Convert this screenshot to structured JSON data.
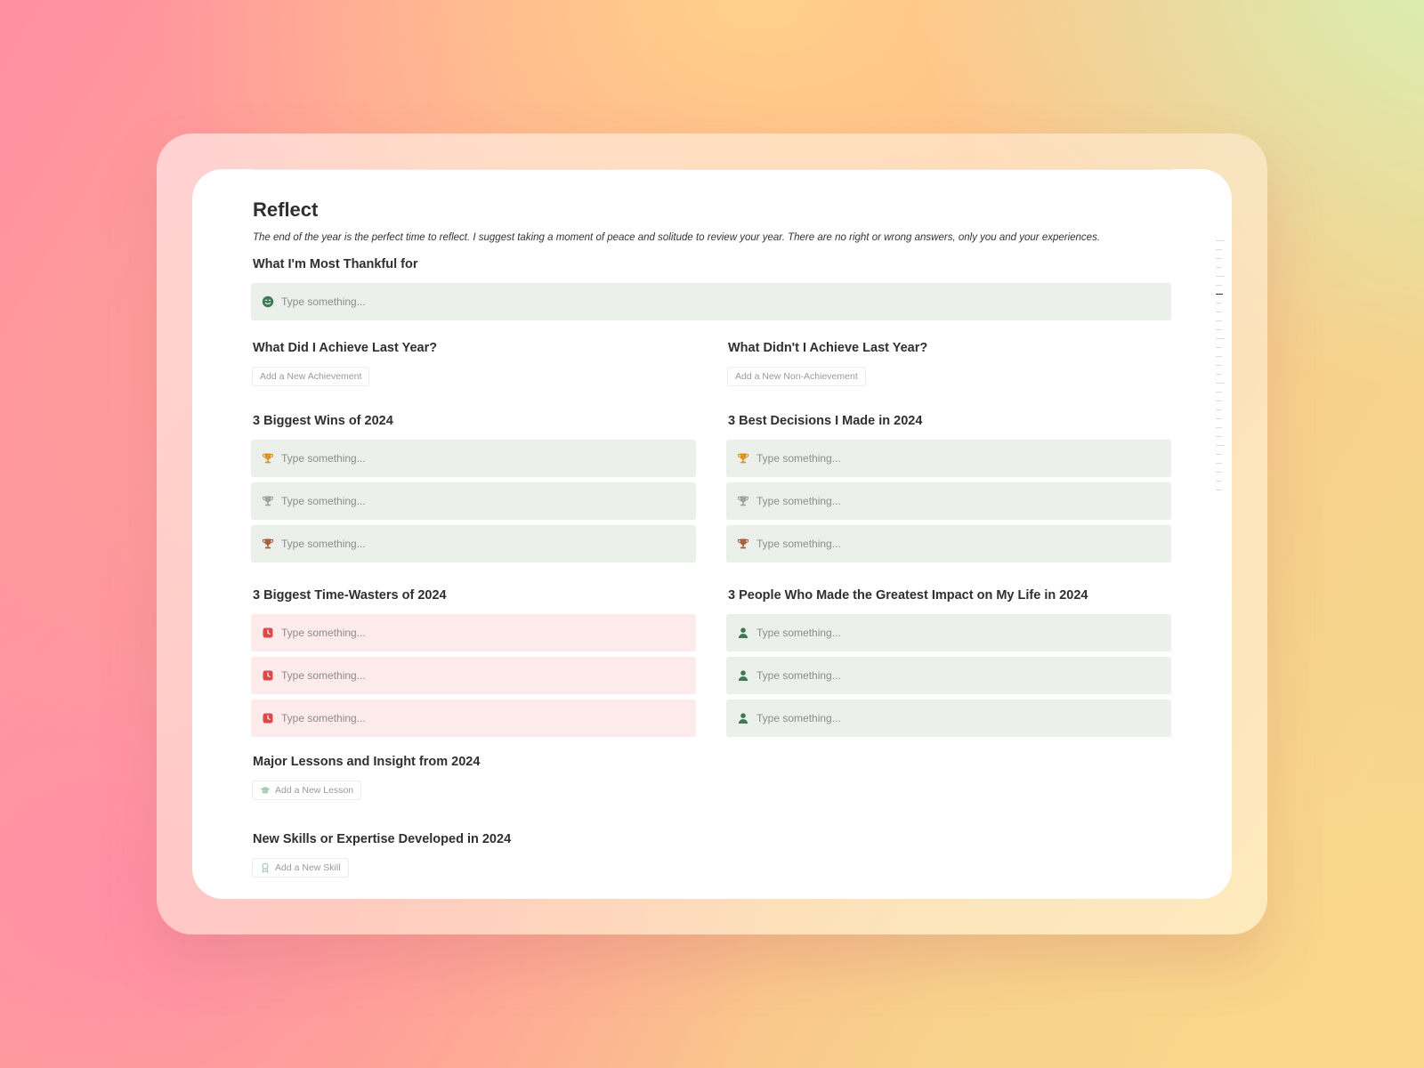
{
  "page": {
    "title": "Reflect",
    "subtitle": "The end of the year is the perfect time to reflect. I suggest taking a moment of peace and solitude to review your year. There are no right or wrong answers, only you and your experiences."
  },
  "thankful": {
    "heading": "What I'm Most Thankful for",
    "placeholder": "Type something..."
  },
  "achieved": {
    "heading": "What Did I Achieve Last Year?",
    "button": "Add a New Achievement"
  },
  "not_achieved": {
    "heading": "What Didn't I Achieve Last Year?",
    "button": "Add a New Non-Achievement"
  },
  "wins": {
    "heading": "3 Biggest Wins of 2024",
    "items": [
      "Type something...",
      "Type something...",
      "Type something..."
    ]
  },
  "decisions": {
    "heading": "3 Best Decisions I Made in 2024",
    "items": [
      "Type something...",
      "Type something...",
      "Type something..."
    ]
  },
  "time_wasters": {
    "heading": "3 Biggest Time-Wasters of 2024",
    "items": [
      "Type something...",
      "Type something...",
      "Type something..."
    ]
  },
  "people": {
    "heading": "3 People Who Made the Greatest Impact on My Life in 2024",
    "items": [
      "Type something...",
      "Type something...",
      "Type something..."
    ]
  },
  "lessons": {
    "heading": "Major Lessons and Insight from 2024",
    "button": "Add a New Lesson"
  },
  "skills": {
    "heading": "New Skills or Expertise Developed in 2024",
    "button": "Add a New Skill"
  },
  "colors": {
    "gold": "#d9952b",
    "silver": "#a3a39c",
    "bronze": "#a8613f",
    "red": "#d94a4a",
    "green": "#3d7a55",
    "box_green": "#ecf0ea",
    "box_red": "#fdeaea"
  },
  "icons": {
    "thankful": "smile-icon",
    "wins": "trophy-icon",
    "decisions": "trophy-icon",
    "time_wasters": "alarm-clock-icon",
    "people": "person-icon",
    "lessons": "graduation-cap-icon",
    "skills": "award-icon"
  }
}
